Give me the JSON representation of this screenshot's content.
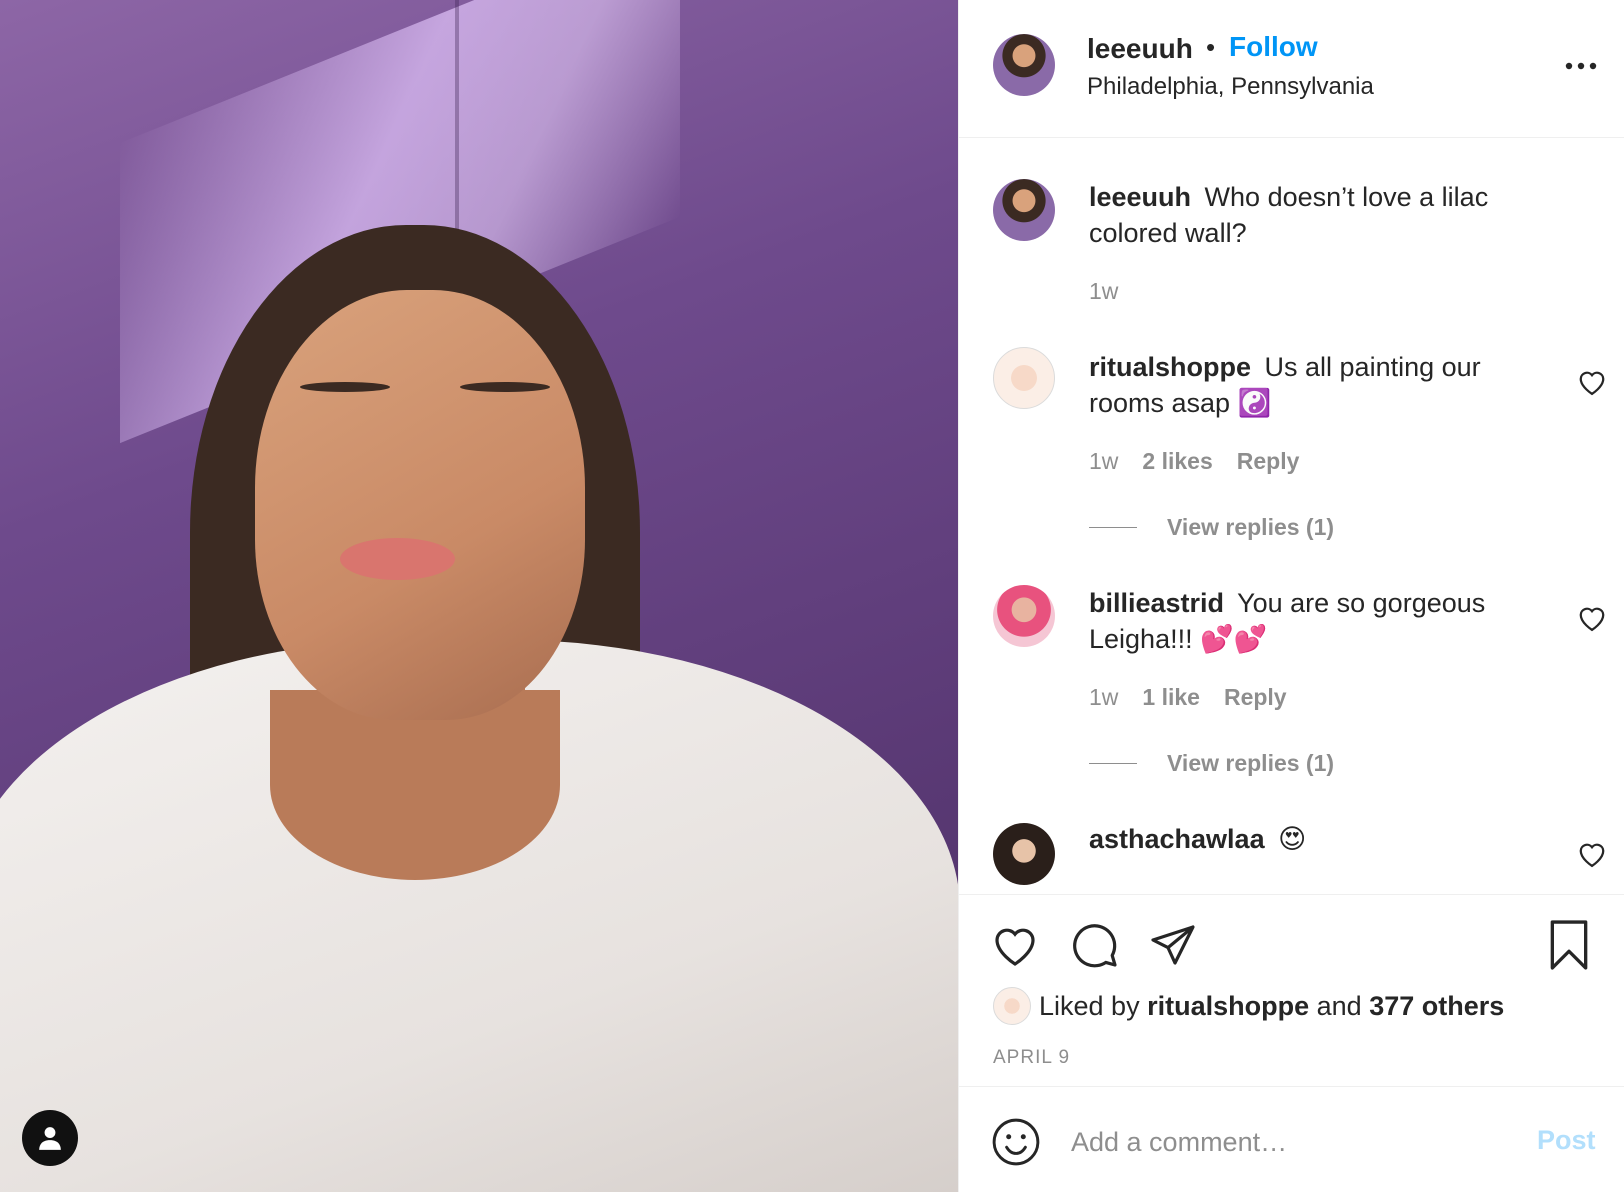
{
  "post": {
    "author": "leeeuuh",
    "follow_label": "Follow",
    "separator": "•",
    "location": "Philadelphia, Pennsylvania",
    "more_icon": "more-horizontal-icon"
  },
  "comments": [
    {
      "username": "leeeuuh",
      "text": "Who doesn’t love a lilac colored wall?",
      "time": "1w"
    },
    {
      "username": "ritualshoppe",
      "text": "Us all painting our rooms asap",
      "emoji": "☯️",
      "time": "1w",
      "likes": "2 likes",
      "reply": "Reply",
      "view_replies": "View replies (1)"
    },
    {
      "username": "billieastrid",
      "text": "You are so gorgeous Leigha!!!",
      "emoji": "💕💕",
      "time": "1w",
      "likes": "1 like",
      "reply": "Reply",
      "view_replies": "View replies (1)"
    },
    {
      "username": "asthachawlaa",
      "text": "",
      "emoji": "😍"
    }
  ],
  "actions": {
    "like_icon": "heart-icon",
    "comment_icon": "comment-icon",
    "share_icon": "send-icon",
    "save_icon": "bookmark-icon"
  },
  "likes": {
    "prefix": "Liked by",
    "user": "ritualshoppe",
    "and": "and",
    "others": "377 others"
  },
  "date": "APRIL 9",
  "composer": {
    "placeholder": "Add a comment…",
    "post_label": "Post"
  },
  "colors": {
    "link_blue": "#0095f6",
    "post_disabled": "#b2dffc",
    "secondary_text": "#8e8e8e",
    "wall_lilac": "#6e4a8c"
  }
}
